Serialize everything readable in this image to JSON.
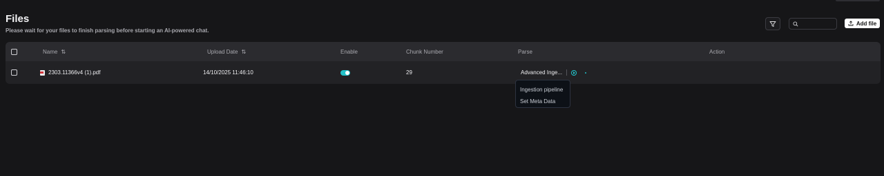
{
  "header": {
    "title": "Files",
    "subtitle": "Please wait for your files to finish parsing before starting an AI-powered chat."
  },
  "toolbar": {
    "filter_icon": "filter-icon",
    "search_placeholder": "",
    "search_value": "",
    "add_label": "Add file"
  },
  "table": {
    "columns": {
      "name": "Name",
      "upload_date": "Upload Date",
      "enable": "Enable",
      "chunk_number": "Chunk Number",
      "parse": "Parse",
      "action": "Action"
    },
    "rows": [
      {
        "name": "2303.11366v4 (1).pdf",
        "upload_date": "14/10/2025 11:46:10",
        "enabled": true,
        "chunk_number": "29",
        "parse": "Advanced Inge..."
      }
    ]
  },
  "parse_menu": {
    "items": [
      "Ingestion pipeline",
      "Set Meta Data"
    ]
  },
  "colors": {
    "accent": "#23c2c9",
    "background": "#161618",
    "table_bg": "#222225",
    "header_bg": "#2b2b2f"
  }
}
